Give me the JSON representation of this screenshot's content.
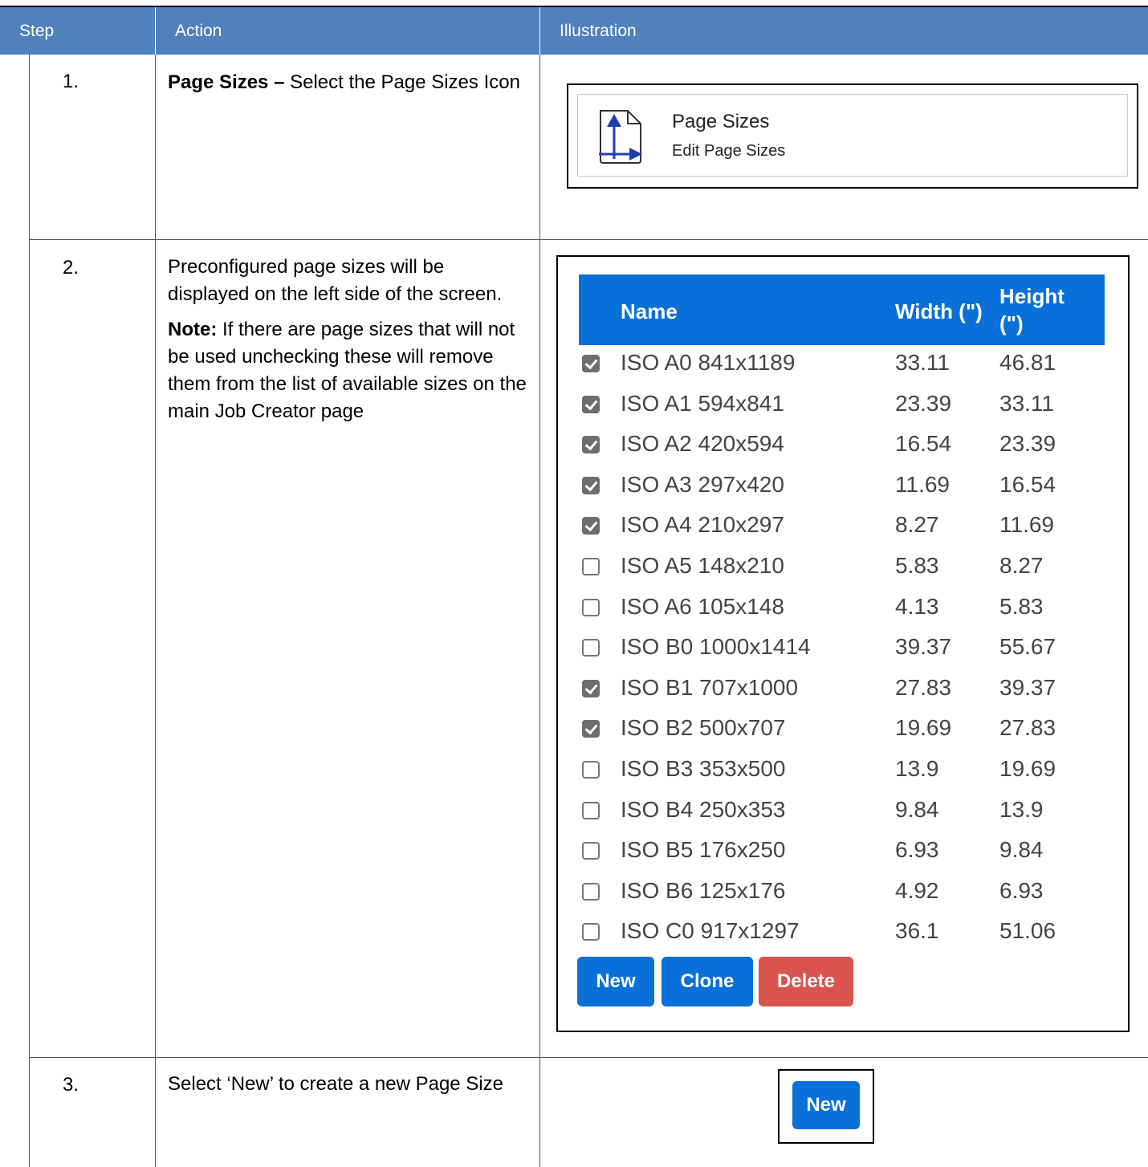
{
  "header": {
    "step": "Step",
    "action": "Action",
    "illustration": "Illustration"
  },
  "rows": [
    {
      "num": "1.",
      "action_bold": "Page Sizes –",
      "action_text": " Select the Page Sizes Icon",
      "illustration": {
        "title": "Page Sizes",
        "subtitle": "Edit Page Sizes",
        "icon": "page-sizes-icon"
      }
    },
    {
      "num": "2.",
      "action_p1": "Preconfigured page sizes will be displayed on the left side of the screen.",
      "note_bold": "Note:",
      "note_text": " If there are page sizes that will not be used unchecking these will remove them from the list of available sizes on the main Job Creator page",
      "illustration": {
        "columns": {
          "name": "Name",
          "width": "Width (\")",
          "height_line1": "Height",
          "height_line2": "(\")"
        },
        "sizes": [
          {
            "checked": true,
            "name": "ISO A0 841x1189",
            "width": "33.11",
            "height": "46.81"
          },
          {
            "checked": true,
            "name": "ISO A1 594x841",
            "width": "23.39",
            "height": "33.11"
          },
          {
            "checked": true,
            "name": "ISO A2 420x594",
            "width": "16.54",
            "height": "23.39"
          },
          {
            "checked": true,
            "name": "ISO A3 297x420",
            "width": "11.69",
            "height": "16.54"
          },
          {
            "checked": true,
            "name": "ISO A4 210x297",
            "width": "8.27",
            "height": "11.69"
          },
          {
            "checked": false,
            "name": "ISO A5 148x210",
            "width": "5.83",
            "height": "8.27"
          },
          {
            "checked": false,
            "name": "ISO A6 105x148",
            "width": "4.13",
            "height": "5.83"
          },
          {
            "checked": false,
            "name": "ISO B0 1000x1414",
            "width": "39.37",
            "height": "55.67"
          },
          {
            "checked": true,
            "name": "ISO B1 707x1000",
            "width": "27.83",
            "height": "39.37"
          },
          {
            "checked": true,
            "name": "ISO B2 500x707",
            "width": "19.69",
            "height": "27.83"
          },
          {
            "checked": false,
            "name": "ISO B3 353x500",
            "width": "13.9",
            "height": "19.69"
          },
          {
            "checked": false,
            "name": "ISO B4 250x353",
            "width": "9.84",
            "height": "13.9"
          },
          {
            "checked": false,
            "name": "ISO B5 176x250",
            "width": "6.93",
            "height": "9.84"
          },
          {
            "checked": false,
            "name": "ISO B6 125x176",
            "width": "4.92",
            "height": "6.93"
          },
          {
            "checked": false,
            "name": "ISO C0 917x1297",
            "width": "36.1",
            "height": "51.06"
          }
        ],
        "buttons": {
          "new": "New",
          "clone": "Clone",
          "delete": "Delete"
        },
        "colors": {
          "primary": "#0a70d9",
          "danger": "#d9534f",
          "header_band": "#4f81bd"
        }
      }
    },
    {
      "num": "3.",
      "action_text": "Select ‘New’ to create a new Page Size",
      "illustration": {
        "button": "New"
      }
    }
  ]
}
